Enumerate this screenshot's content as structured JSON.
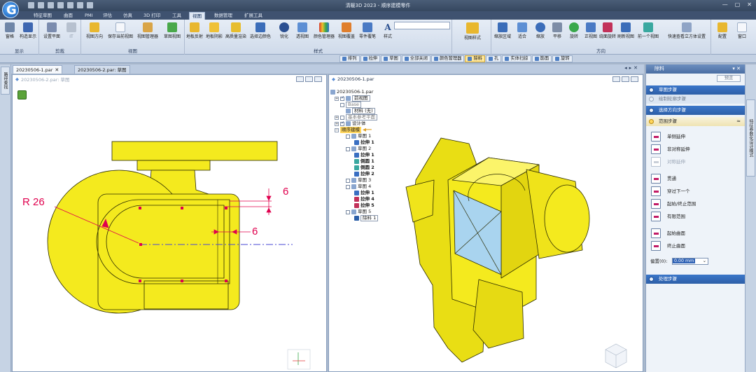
{
  "app": {
    "title": "清暖3D 2023 - 顺序建模零件",
    "logo_letter": "G"
  },
  "menu_tabs": [
    "特征草图",
    "曲面",
    "PMI",
    "评估",
    "仿真",
    "3D 打印",
    "工具",
    "视图",
    "数据管理",
    "扩展工具"
  ],
  "ribbon": {
    "groups": [
      {
        "label": "显示",
        "buttons": [
          "窗格",
          "构造显示"
        ]
      },
      {
        "label": "剪裁",
        "buttons": [
          "设置平面",
          "IT"
        ]
      },
      {
        "label": "视图",
        "buttons": [
          "视图方向",
          "保存当前视图",
          "视图管理器",
          "草图视图"
        ]
      },
      {
        "label": "样式",
        "buttons": [
          "地板反射",
          "地板阴影",
          "高质量渲染",
          "选择边颜色",
          "锐化",
          "透视图",
          "颜色管理器",
          "视图覆盖",
          "零件覆笔",
          "样式"
        ]
      },
      {
        "label": "",
        "buttons": [
          "视图样式"
        ]
      },
      {
        "label": "方向",
        "buttons": [
          "缩放区域",
          "适合",
          "缩放",
          "平移",
          "旋转",
          "正视图",
          "绕面旋转",
          "刷新视图",
          "前一个视图",
          "快速查看立方体设置"
        ]
      },
      {
        "label": "",
        "buttons": [
          "配置",
          "窗口"
        ]
      }
    ]
  },
  "feature_bar": [
    {
      "label": "排列",
      "active": false
    },
    {
      "label": "拉伸",
      "active": false
    },
    {
      "label": "草图",
      "active": false
    },
    {
      "label": "全部关闭",
      "active": false
    },
    {
      "label": "颜色管理器",
      "active": false
    },
    {
      "label": "除料",
      "active": true
    },
    {
      "label": "孔",
      "active": false
    },
    {
      "label": "实体扫掠",
      "active": false
    },
    {
      "label": "筋面",
      "active": false
    },
    {
      "label": "旋转",
      "active": false
    }
  ],
  "left_strip": {
    "label": "路径查找"
  },
  "doc_tabs": [
    {
      "label": "20230506-1.par",
      "active": true
    },
    {
      "label": "20230506-2.par: 草图",
      "active": false
    }
  ],
  "views": {
    "left": {
      "title": "20230506-2.par: 草图"
    },
    "right": {
      "title": "20230506-1.par"
    }
  },
  "dims": {
    "radius": "R 26",
    "d1": "6",
    "d2": "6"
  },
  "tree": [
    {
      "text": "20230506-1.par",
      "ind": 0
    },
    {
      "text": "前视图",
      "ind": 1,
      "box": true,
      "checked": true
    },
    {
      "text": "Base",
      "ind": 1,
      "bx": true
    },
    {
      "text": "材料 (无)",
      "ind": 2
    },
    {
      "text": "基本参考平面",
      "ind": 1,
      "bx": true
    },
    {
      "text": "设计体",
      "ind": 1,
      "checked": true
    },
    {
      "text": "顺序建模",
      "ind": 1,
      "hl": true
    },
    {
      "text": "草图 1",
      "ind": 2
    },
    {
      "text": "拉伸 1",
      "ind": 3
    },
    {
      "text": "草图 2",
      "ind": 2
    },
    {
      "text": "拉伸 1",
      "ind": 3
    },
    {
      "text": "倒圆 1",
      "ind": 3
    },
    {
      "text": "倒圆 2",
      "ind": 3
    },
    {
      "text": "拉伸 2",
      "ind": 3
    },
    {
      "text": "草图 3",
      "ind": 2
    },
    {
      "text": "草图 4",
      "ind": 2
    },
    {
      "text": "拉伸 1",
      "ind": 3
    },
    {
      "text": "拉伸 4",
      "ind": 3
    },
    {
      "text": "拉伸 5",
      "ind": 3
    },
    {
      "text": "草图 5",
      "ind": 2
    },
    {
      "text": "除料 1",
      "ind": 3
    }
  ],
  "rpanel": {
    "title": "除料",
    "preview_btn": "预览",
    "steps": {
      "sketch": "草图步骤",
      "draw": "绘制轮廓步骤",
      "direction": "选择方向步骤",
      "extent": "范围步骤",
      "treatment": "处理步骤"
    },
    "options_a": [
      {
        "label": "单侧延伸",
        "dim": false
      },
      {
        "label": "非对称延伸",
        "dim": false
      },
      {
        "label": "对称延伸",
        "dim": true
      }
    ],
    "options_b": [
      {
        "label": "贯通",
        "dim": false
      },
      {
        "label": "穿过下一个",
        "dim": false
      },
      {
        "label": "起始/终止范围",
        "dim": false
      },
      {
        "label": "有限范围",
        "dim": false
      }
    ],
    "options_c": [
      {
        "label": "起始曲面",
        "dim": false
      },
      {
        "label": "终止曲面",
        "dim": false
      }
    ],
    "dist_label": "偏置(0):",
    "dist_value": "0.00 mm"
  },
  "rp_strip": {
    "label": "特征参数化设计模式"
  },
  "colors": {
    "part_yellow": "#f4ea1e",
    "dim_red": "#e0004e",
    "face_blue": "#a9d4ef",
    "accent": "#2d5fa8"
  }
}
